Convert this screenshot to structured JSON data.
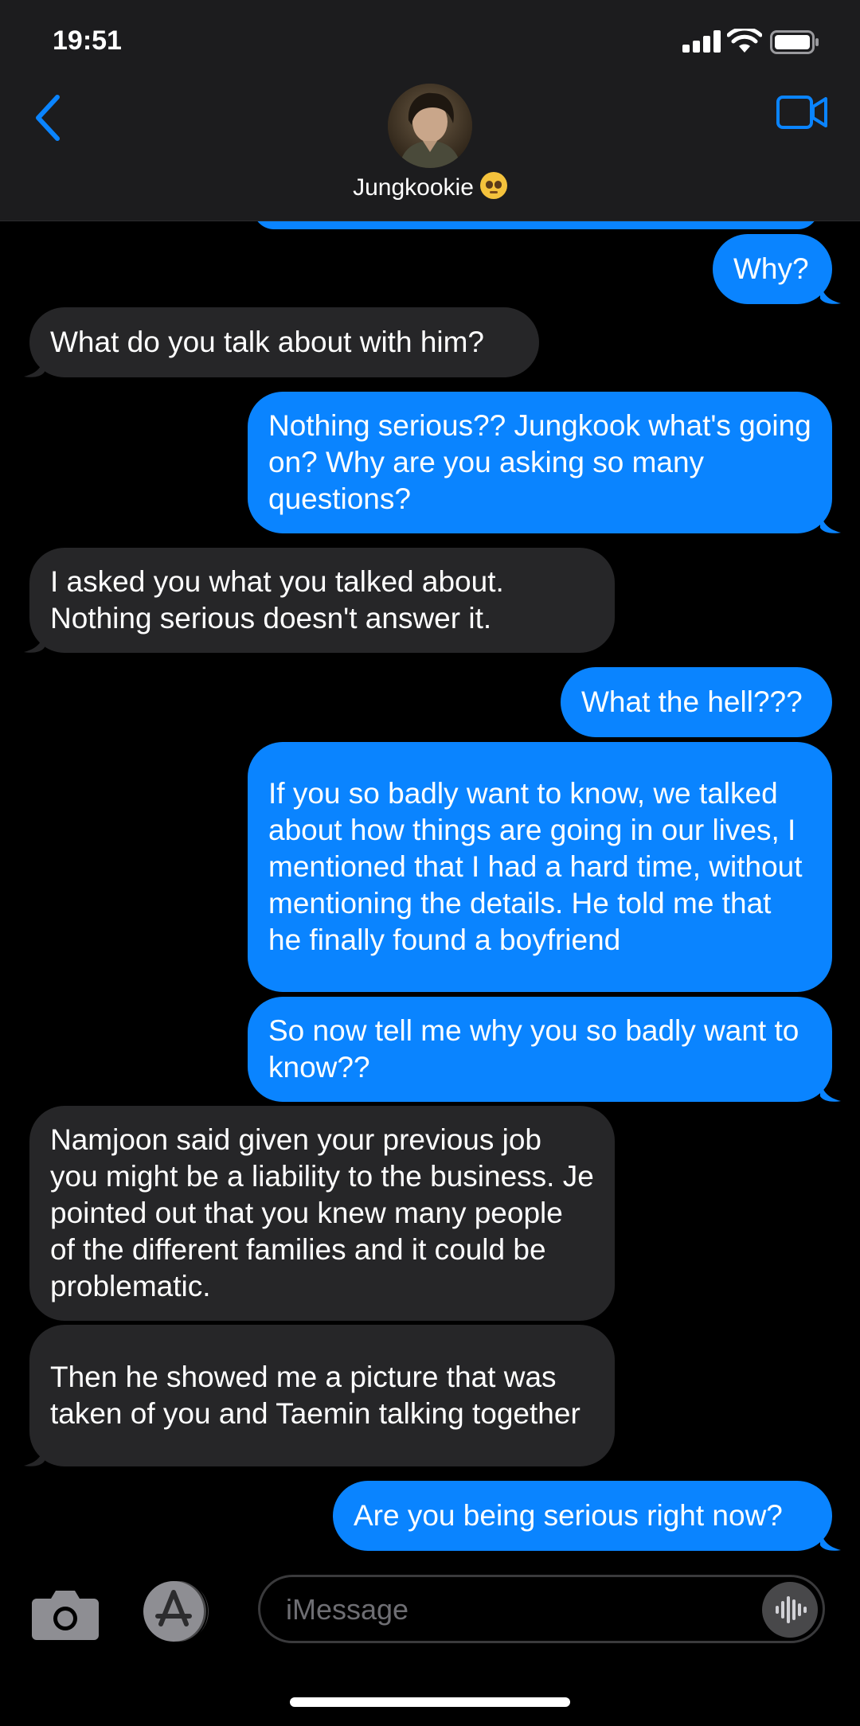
{
  "status_bar": {
    "time": "19:51"
  },
  "header": {
    "contact_name": "Jungkookie",
    "contact_emoji": "pleading-face-emoji",
    "back_icon": "chevron-left-icon",
    "video_icon": "video-camera-icon"
  },
  "messages": [
    {
      "from": "me",
      "text": ""
    },
    {
      "from": "me",
      "text": "Why?"
    },
    {
      "from": "them",
      "text": "What do you talk about with him?"
    },
    {
      "from": "me",
      "text": "Nothing serious?? Jungkook what's going on? Why are you asking so many questions?"
    },
    {
      "from": "them",
      "text": "I asked you what you talked about. Nothing serious doesn't answer it."
    },
    {
      "from": "me",
      "text": "What the hell???"
    },
    {
      "from": "me",
      "text": "If you so badly want to know, we talked about how things are going in our lives, I mentioned that I had a hard time, without mentioning the details. He told me that he finally found a boyfriend"
    },
    {
      "from": "me",
      "text": "So now tell me why you so badly want to know??"
    },
    {
      "from": "them",
      "text": "Namjoon said given your previous job you might be a liability to the business. Je pointed out that you knew many people of the different families and it could be problematic."
    },
    {
      "from": "them",
      "text": "Then he showed me a picture that was taken of you and Taemin talking together"
    },
    {
      "from": "me",
      "text": "Are you being serious right now?"
    }
  ],
  "input_bar": {
    "placeholder": "iMessage",
    "value": "",
    "camera_icon": "camera-icon",
    "apps_icon": "app-store-icon",
    "audio_icon": "audio-waveform-icon"
  },
  "colors": {
    "outgoing_bubble": "#0a84ff",
    "incoming_bubble": "#262628",
    "header_bg": "#1c1c1e",
    "background": "#000000"
  }
}
